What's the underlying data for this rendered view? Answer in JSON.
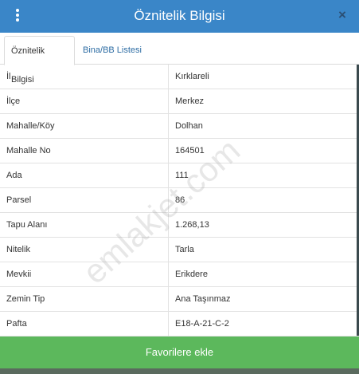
{
  "header": {
    "title": "Öznitelik Bilgisi",
    "close_glyph": "×",
    "accent": "#3a86c8"
  },
  "tabs": [
    {
      "label": "Öznitelik Bilgisi",
      "active": true
    },
    {
      "label": "Bina/BB Listesi",
      "active": false
    }
  ],
  "rows": [
    {
      "key": "İl",
      "value": "Kırklareli"
    },
    {
      "key": "İlçe",
      "value": "Merkez"
    },
    {
      "key": "Mahalle/Köy",
      "value": "Dolhan"
    },
    {
      "key": "Mahalle No",
      "value": "164501"
    },
    {
      "key": "Ada",
      "value": "111"
    },
    {
      "key": "Parsel",
      "value": "86"
    },
    {
      "key": "Tapu Alanı",
      "value": "1.268,13"
    },
    {
      "key": "Nitelik",
      "value": "Tarla"
    },
    {
      "key": "Mevkii",
      "value": "Erikdere"
    },
    {
      "key": "Zemin Tip",
      "value": "Ana Taşınmaz"
    },
    {
      "key": "Pafta",
      "value": "E18-A-21-C-2"
    }
  ],
  "watermark": "emlakjet.com",
  "footer": {
    "favorite_label": "Favorilere ekle",
    "color": "#5cb85c"
  }
}
